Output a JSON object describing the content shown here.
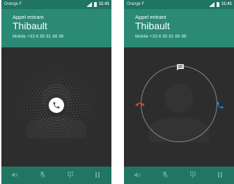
{
  "screens": [
    {
      "status": {
        "carrier": "Orange F",
        "time": "11:41"
      },
      "header": {
        "label": "Appel entrant",
        "caller": "Thibault",
        "number": "Mobile +33 6 85 81 66 96"
      },
      "controls": [
        "speaker-icon",
        "mute-icon",
        "dialpad-icon",
        "hold-icon"
      ]
    },
    {
      "status": {
        "carrier": "Orange F",
        "time": "11:41"
      },
      "header": {
        "label": "Appel entrant",
        "caller": "Thibault",
        "number": "Mobile +33 6 85 81 66 96"
      },
      "controls": [
        "speaker-icon",
        "mute-icon",
        "dialpad-icon",
        "hold-icon"
      ]
    }
  ],
  "colors": {
    "status_bar": "#1f7463",
    "header": "#2a8a75",
    "background": "#2d2d2d",
    "decline": "#e53935",
    "answer": "#1e88e5"
  }
}
